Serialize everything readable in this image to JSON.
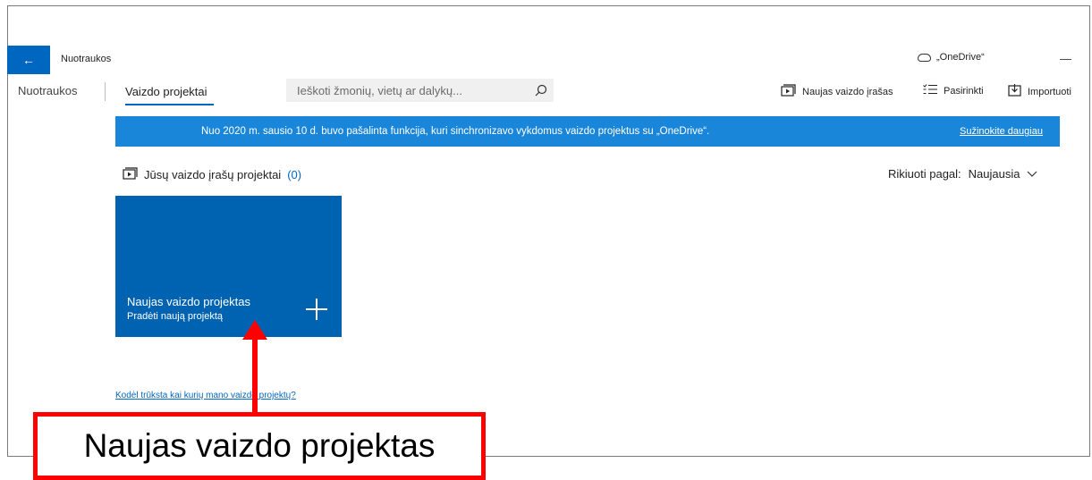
{
  "app": {
    "back_glyph": "←",
    "title": "Nuotraukos",
    "onedrive_label": "„OneDrive“",
    "minimize_glyph": "—"
  },
  "nav": {
    "photos": "Nuotraukos",
    "video_projects": "Vaizdo projektai"
  },
  "search": {
    "placeholder": "Ieškoti žmonių, vietų ar dalykų..."
  },
  "commands": {
    "new_video": "Naujas vaizdo įrašas",
    "select": "Pasirinkti",
    "import": "Importuoti"
  },
  "banner": {
    "text": "Nuo 2020 m. sausio 10 d. buvo pašalinta funkcija, kuri sinchronizavo vykdomus vaizdo projektus su „OneDrive“.",
    "link": "Sužinokite daugiau"
  },
  "section": {
    "title": "Jūsų vaizdo įrašų projektai",
    "count": "(0)"
  },
  "sort": {
    "label": "Rikiuoti pagal:",
    "value": "Naujausia"
  },
  "tile": {
    "title": "Naujas vaizdo projektas",
    "subtitle": "Pradėti naują projektą"
  },
  "help_link": "Kodėl trūksta kai kurių mano vaizdo projektų?",
  "callout": {
    "text": "Naujas vaizdo projektas"
  },
  "colors": {
    "accent": "#0067c0",
    "banner": "#1a86d9",
    "tile": "#0063b1",
    "callout": "#ff0000"
  },
  "icons": [
    "back-arrow-icon",
    "cloud-icon",
    "minimize-icon",
    "search-icon",
    "video-icon",
    "select-list-icon",
    "import-icon",
    "chevron-down-icon",
    "plus-icon"
  ]
}
